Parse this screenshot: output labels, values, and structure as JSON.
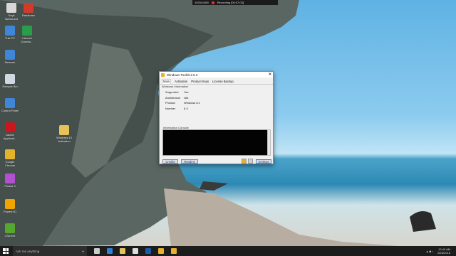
{
  "recording_bar": {
    "resolution": "1920x1080",
    "status": "Recording [00:07:03]"
  },
  "desktop_icons": [
    {
      "label": "Seyit\nMahmood",
      "icon": "user-folder-icon",
      "color": "#d8d8d8"
    },
    {
      "label": "Bandicam",
      "icon": "bandicam-icon",
      "color": "#d23b2b"
    },
    {
      "label": "This PC",
      "icon": "computer-icon",
      "color": "#3f86d8"
    },
    {
      "label": "Internet\nDownlo...",
      "icon": "internet-download-manager-icon",
      "color": "#2a9d4a"
    },
    {
      "label": "Network",
      "icon": "network-icon",
      "color": "#3f86d8"
    },
    {
      "label": "Recycle Bin",
      "icon": "recycle-bin-icon",
      "color": "#cfd8e3"
    },
    {
      "label": "Control Panel",
      "icon": "control-panel-icon",
      "color": "#3f86d8"
    },
    {
      "label": "Adobe\nApplicati...",
      "icon": "adobe-icon",
      "color": "#c8181e"
    },
    {
      "label": "Windows 10\nActivation",
      "icon": "folder-icon",
      "color": "#e6c35a"
    },
    {
      "label": "Google\nChrome",
      "icon": "chrome-icon",
      "color": "#e4b22d"
    },
    {
      "label": "Picasa 3",
      "icon": "picasa-icon",
      "color": "#b34fd1"
    },
    {
      "label": "PowerISO",
      "icon": "poweriso-icon",
      "color": "#f0a500"
    },
    {
      "label": "uTorrent",
      "icon": "utorrent-icon",
      "color": "#56a72d"
    }
  ],
  "dialog": {
    "title": "Windows Toolkit 2.5.3",
    "close": "✕",
    "tabs": [
      "Main",
      "Activation",
      "Product Keys",
      "License Backup"
    ],
    "info_legend": "Windows Information",
    "info": [
      {
        "label": "Supported",
        "value": "Yes"
      },
      {
        "label": "Architecture",
        "value": "x64"
      },
      {
        "label": "Product",
        "value": "Windows 8.1"
      },
      {
        "label": "Number",
        "value": "6.3"
      }
    ],
    "console_label": "Information Console",
    "buttons": {
      "credits": "Credits",
      "readme": "Readme",
      "settings": "Settings"
    }
  },
  "taskbar": {
    "search_placeholder": "Ask me anything",
    "time": "12:40 AM",
    "date": "5/26/2016",
    "apps": [
      {
        "icon": "task-view-icon",
        "color": "#cccccc"
      },
      {
        "icon": "edge-icon",
        "color": "#2f7fd6"
      },
      {
        "icon": "file-explorer-icon",
        "color": "#e6c35a"
      },
      {
        "icon": "store-icon",
        "color": "#dddddd"
      },
      {
        "icon": "photoshop-icon",
        "color": "#1e5aa8"
      },
      {
        "icon": "chrome-icon",
        "color": "#e4b22d"
      },
      {
        "icon": "toolkit-icon",
        "color": "#e8b12b"
      }
    ]
  }
}
